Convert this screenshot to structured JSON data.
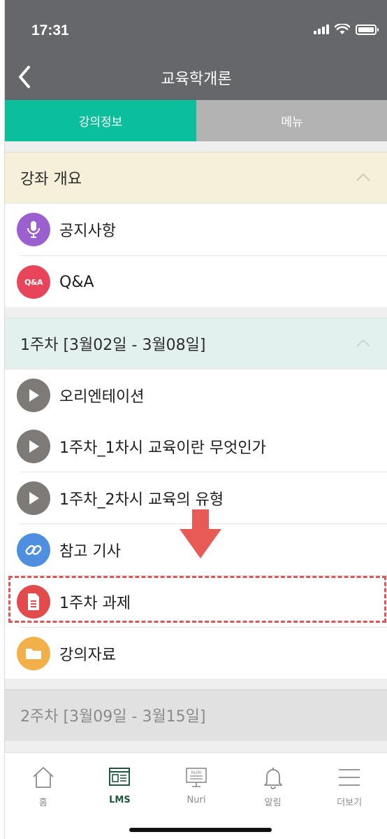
{
  "status_bar": {
    "time": "17:31"
  },
  "header": {
    "title": "교육학개론",
    "back_icon": "chevron-left-icon"
  },
  "tabs": [
    {
      "label": "강의정보",
      "active": true
    },
    {
      "label": "메뉴",
      "active": false
    }
  ],
  "sections": [
    {
      "title": "강좌 개요",
      "expanded": true,
      "items": [
        {
          "label": "공지사항",
          "icon": "microphone-icon",
          "color": "#9b5fd0"
        },
        {
          "label": "Q&A",
          "icon": "qa-icon",
          "icon_text": "Q&A",
          "color": "#e8455a"
        }
      ]
    },
    {
      "title": "1주차 [3월02일 - 3월08일]",
      "expanded": true,
      "items": [
        {
          "label": "오리엔테이션",
          "icon": "play-icon",
          "color": "#7d7a77"
        },
        {
          "label": "1주차_1차시 교육이란 무엇인가",
          "icon": "play-icon",
          "color": "#7d7a77"
        },
        {
          "label": "1주차_2차시 교육의 유형",
          "icon": "play-icon",
          "color": "#7d7a77"
        },
        {
          "label": "참고 기사",
          "icon": "link-icon",
          "color": "#4f8fe0"
        },
        {
          "label": "1주차 과제",
          "icon": "document-icon",
          "color": "#e24b4b",
          "highlighted": true
        },
        {
          "label": "강의자료",
          "icon": "folder-icon",
          "color": "#f2b04a"
        }
      ]
    },
    {
      "title": "2주차 [3월09일 - 3월15일]",
      "expanded": false,
      "items": []
    }
  ],
  "bottom_nav": [
    {
      "label": "홈",
      "icon": "home-icon",
      "active": false
    },
    {
      "label": "LMS",
      "icon": "lms-icon",
      "active": true
    },
    {
      "label": "Nuri",
      "icon": "nuri-icon",
      "icon_text": "NURI",
      "active": false
    },
    {
      "label": "알림",
      "icon": "bell-icon",
      "active": false
    },
    {
      "label": "더보기",
      "icon": "menu-icon",
      "active": false
    }
  ],
  "colors": {
    "header_bg": "#66676b",
    "tab_active": "#0bbf9c",
    "tab_inactive": "#b3b3b3",
    "highlight": "#e05555",
    "nav_active": "#1d5a3c"
  }
}
